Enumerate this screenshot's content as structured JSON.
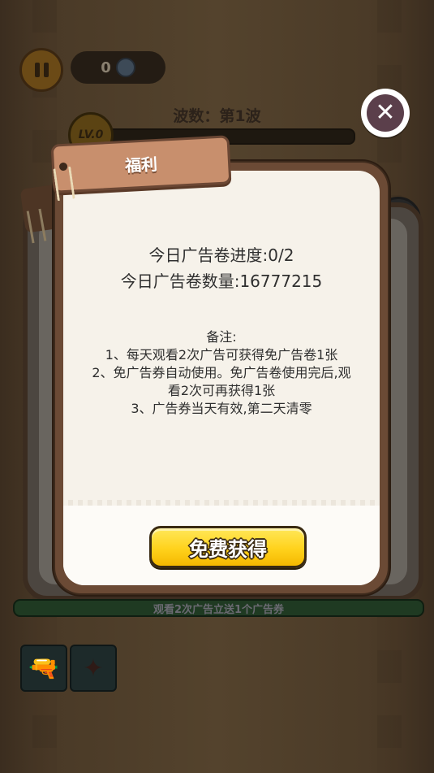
{
  "hud": {
    "coin_count": "0",
    "wave_label": "波数：第1波",
    "level_label": "LV.0",
    "bottom_banner": "观看2次广告立送1个广告券"
  },
  "modal": {
    "title": "福利",
    "progress_label": "今日广告卷进度:0/2",
    "count_label": "今日广告卷数量:16777215",
    "notes_title": "备注:",
    "notes": [
      "1、每天观看2次广告可获得免广告卷1张",
      "2、免广告券自动使用。免广告卷使用完后,观",
      "看2次可再获得1张",
      "3、广告券当天有效,第二天清零"
    ],
    "claim_button": "免费获得",
    "close_icon": "✕"
  },
  "icons": {
    "pause": "pause-icon",
    "gem": "gem-icon",
    "close": "close-icon",
    "water_gun": "water-gun-icon",
    "shuriken": "shuriken-icon"
  },
  "colors": {
    "claim_button": "#ffd21c",
    "panel_border": "#6b4a35",
    "title_tag": "#c88f6d",
    "close_button": "#5b3f4b"
  }
}
